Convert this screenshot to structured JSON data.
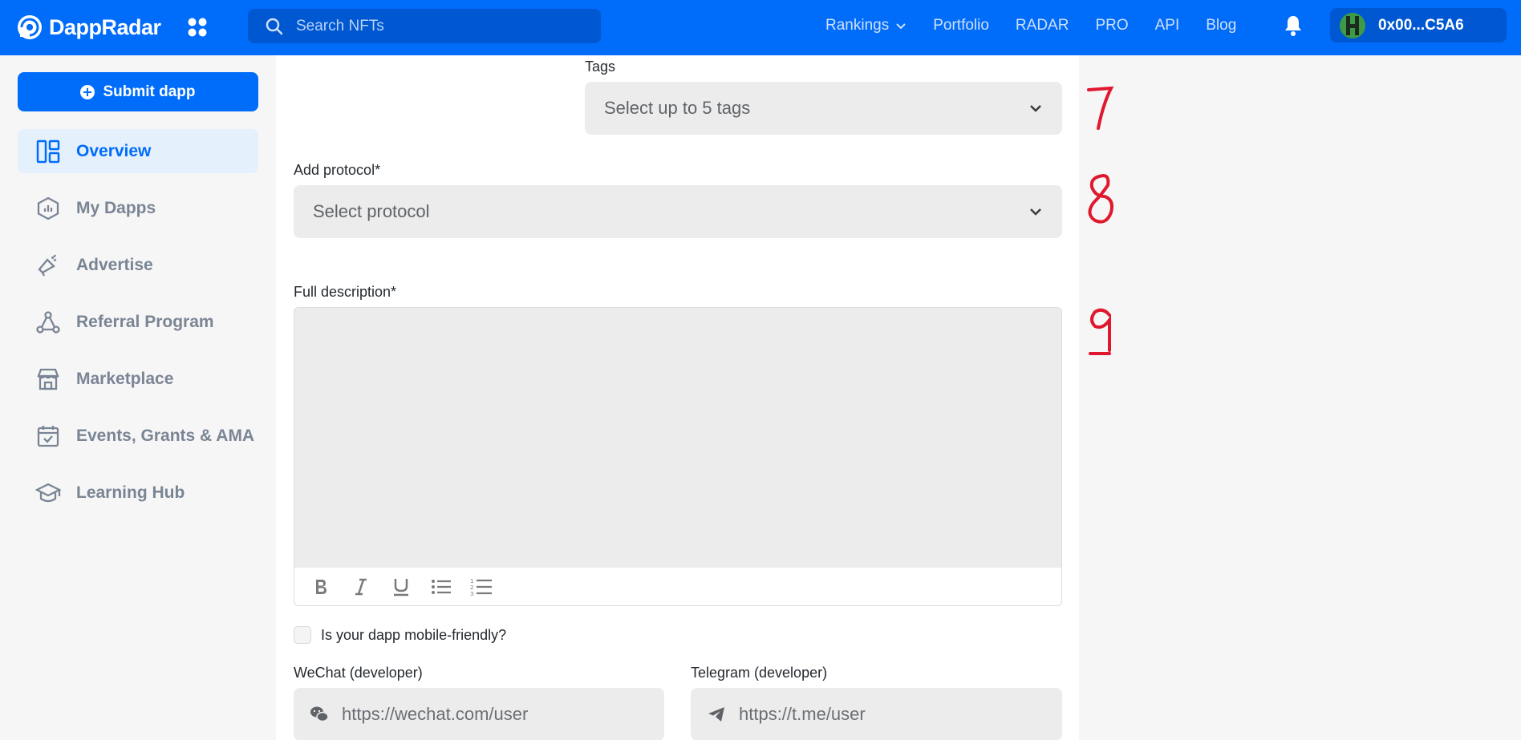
{
  "app": {
    "brand": "DappRadar",
    "search_placeholder": "Search NFTs",
    "nav": [
      "Rankings",
      "Portfolio",
      "RADAR",
      "PRO",
      "API",
      "Blog"
    ],
    "wallet_address": "0x00...C5A6"
  },
  "sidebar": {
    "submit_label": "Submit dapp",
    "items": [
      {
        "label": "Overview",
        "icon": "overview-icon",
        "active": true
      },
      {
        "label": "My Dapps",
        "icon": "hexagon-chart-icon"
      },
      {
        "label": "Advertise",
        "icon": "megaphone-icon"
      },
      {
        "label": "Referral Program",
        "icon": "network-icon"
      },
      {
        "label": "Marketplace",
        "icon": "store-icon"
      },
      {
        "label": "Events, Grants & AMA",
        "icon": "calendar-check-icon"
      },
      {
        "label": "Learning Hub",
        "icon": "graduation-cap-icon"
      }
    ]
  },
  "form": {
    "tags_label": "Tags",
    "tags_placeholder": "Select up to 5 tags",
    "protocol_label": "Add protocol*",
    "protocol_placeholder": "Select protocol",
    "description_label": "Full description*",
    "mobile_label": "Is your dapp mobile-friendly?",
    "wechat_label": "WeChat (developer)",
    "wechat_placeholder": "https://wechat.com/user",
    "telegram_label": "Telegram (developer)",
    "telegram_placeholder": "https://t.me/user"
  },
  "annotations": [
    "7",
    "8",
    "9"
  ],
  "colors": {
    "primary": "#006cfa",
    "annotation": "#e0182d"
  }
}
